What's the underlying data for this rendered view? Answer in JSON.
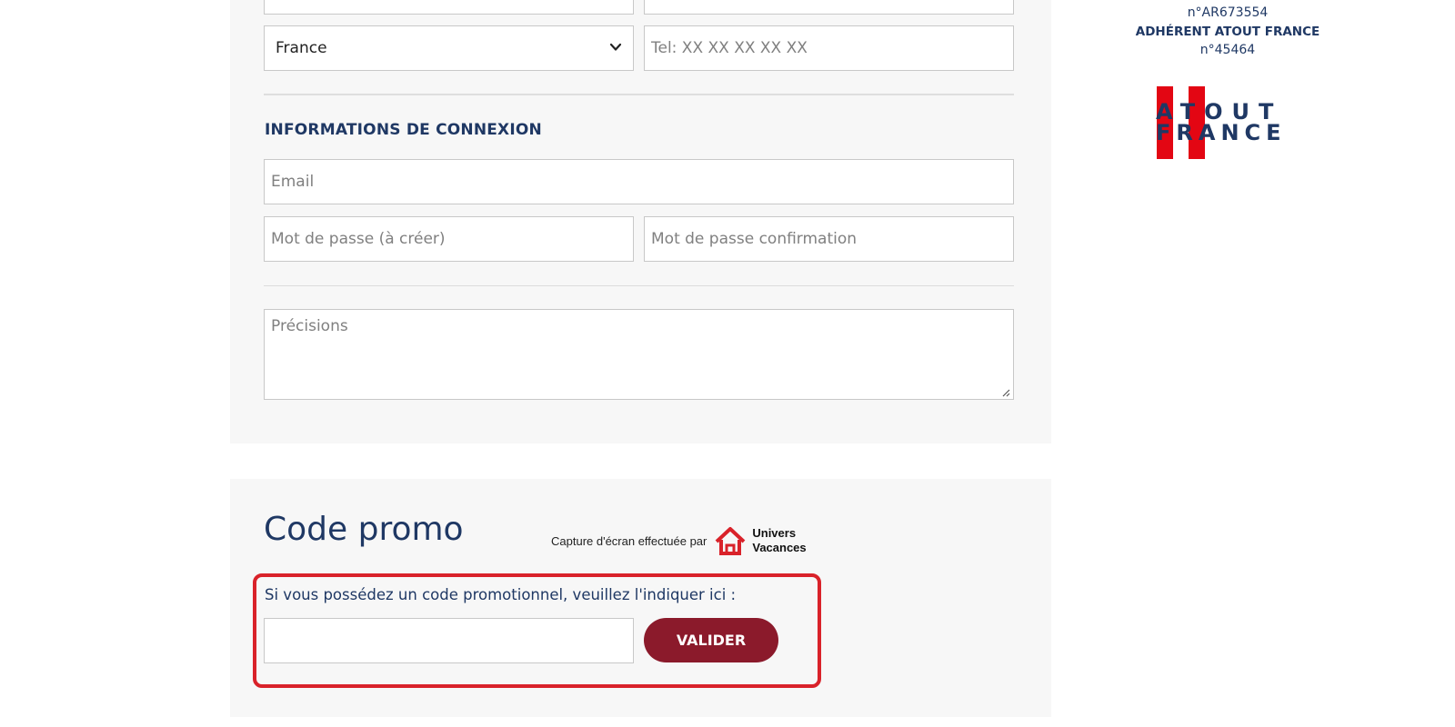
{
  "colors": {
    "brand_navy": "#1f3864",
    "button_red": "#8b1a2b",
    "highlight_red": "#d9222a",
    "panel_bg": "#f7f7f7"
  },
  "contact": {
    "country_select": {
      "selected": "France",
      "icon": "chevron-down-icon"
    },
    "phone_placeholder": "Tel: XX XX XX XX XX"
  },
  "login_section": {
    "title": "INFORMATIONS DE CONNEXION",
    "email_placeholder": "Email",
    "password_placeholder": "Mot de passe (à créer)",
    "password_confirm_placeholder": "Mot de passe confirmation"
  },
  "details": {
    "precisions_placeholder": "Précisions"
  },
  "promo": {
    "title": "Code promo",
    "credit_text": "Capture d'écran effectuée par",
    "credit_brand_line1": "Univers",
    "credit_brand_line2": "Vacances",
    "instruction": "Si vous possédez un code promotionnel, veuillez l'indiquer ici :",
    "code_value": "",
    "submit_label": "VALIDER"
  },
  "sidebar": {
    "registration_number": "n°AR673554",
    "membership_label": "ADHÉRENT ATOUT FRANCE",
    "membership_number": "n°45464",
    "logo_line1": "ATOUT",
    "logo_line2": "FRANCE"
  }
}
